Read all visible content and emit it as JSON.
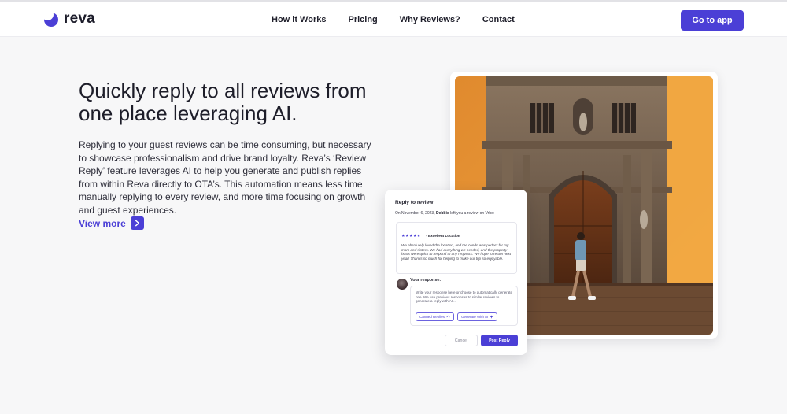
{
  "brand": {
    "name": "reva",
    "accent": "#4b3fd6"
  },
  "nav": {
    "items": [
      "How it Works",
      "Pricing",
      "Why Reviews?",
      "Contact"
    ],
    "cta_label": "Go to app"
  },
  "hero": {
    "title": "Quickly reply to all reviews from one place leveraging AI.",
    "body": "Replying to your guest reviews can be time consuming, but necessary to showcase professionalism and drive brand loyalty. Reva’s ‘Review Reply’ feature leverages AI to help you generate and publish replies from within Reva directly to OTA’s. This automation means less time manually replying to every review, and more time focusing on growth and guest experiences.",
    "view_more_label": "View more",
    "view_more_icon": "chevron-right-icon"
  },
  "review_card": {
    "title": "Reply to review",
    "meta_prefix": "On November 6, 2023, ",
    "meta_author": "Debbie",
    "meta_suffix": " left you a review on Vrbo:",
    "rating_stars": "★★★★★",
    "rating_value": 5,
    "review_title": "- Excellent Location",
    "review_text": "We absolutely loved the location, and the condo was perfect for my mom and sisters. We had everything we needed, and the property hosts were quick to respond to any requests. We hope to return next year! Thanks so much for helping to make our trip so enjoyable.",
    "response_label": "Your response:",
    "response_placeholder": "Write your response here or choose to automatically generate one. We use previous responses to similar reviews to generate a reply with AI...",
    "canned_replies_label": "Canned Replies",
    "generate_ai_label": "Generate With AI",
    "cancel_label": "Cancel",
    "post_reply_label": "Post Reply"
  }
}
